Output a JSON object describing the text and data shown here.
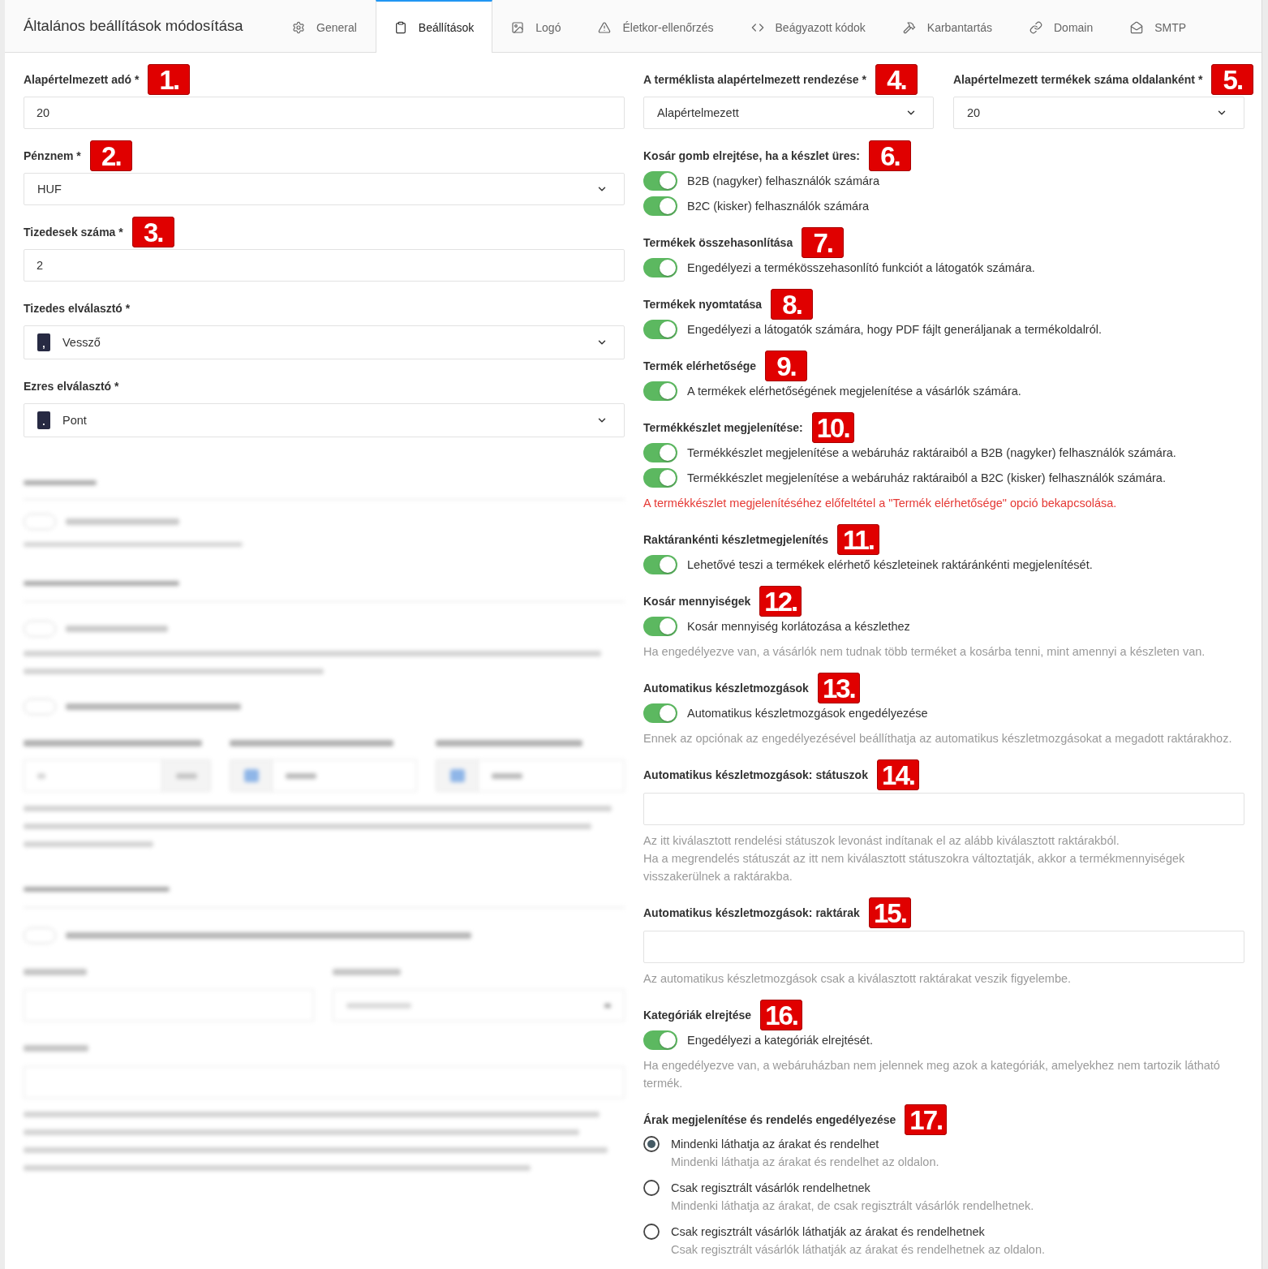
{
  "header": {
    "title": "Általános beállítások módosítása"
  },
  "tabs": [
    {
      "label": "General",
      "selected": false
    },
    {
      "label": "Beállítások",
      "selected": true
    },
    {
      "label": "Logó",
      "selected": false
    },
    {
      "label": "Életkor-ellenőrzés",
      "selected": false
    },
    {
      "label": "Beágyazott kódok",
      "selected": false
    },
    {
      "label": "Karbantartás",
      "selected": false
    },
    {
      "label": "Domain",
      "selected": false
    },
    {
      "label": "SMTP",
      "selected": false
    }
  ],
  "general_fields": [
    {
      "kind": "input",
      "label": "Alapértelmezett adó *",
      "marker": "1.",
      "value": "20"
    },
    {
      "kind": "select",
      "label": "Pénznem *",
      "marker": "2.",
      "value": "HUF"
    },
    {
      "kind": "input",
      "label": "Tizedesek száma *",
      "marker": "3.",
      "value": "2"
    },
    {
      "kind": "select",
      "label": "Tizedes elválasztó *",
      "symbol": ",",
      "value": "Vessző"
    },
    {
      "kind": "select",
      "label": "Ezres elválasztó *",
      "symbol": ".",
      "value": "Pont"
    }
  ],
  "list_fields": [
    {
      "label": "A terméklista alapértelmezett rendezése *",
      "marker": "4.",
      "value": "Alapértelmezett"
    },
    {
      "label": "Alapértelmezett termékek száma oldalanként *",
      "marker": "5.",
      "value": "20"
    }
  ],
  "sections": [
    {
      "title": "Kosár gomb elrejtése, ha a készlet üres:",
      "marker": "6.",
      "items": [
        {
          "kind": "toggle",
          "label": "B2B (nagyker) felhasználók számára",
          "on": true
        },
        {
          "kind": "toggle",
          "label": "B2C (kisker) felhasználók számára",
          "on": true
        }
      ]
    },
    {
      "title": "Termékek összehasonlítása",
      "marker": "7.",
      "items": [
        {
          "kind": "toggle",
          "label": "Engedélyezi a termékösszehasonlító funkciót a látogatók számára.",
          "on": true
        }
      ]
    },
    {
      "title": "Termékek nyomtatása",
      "marker": "8.",
      "items": [
        {
          "kind": "toggle",
          "label": "Engedélyezi a látogatók számára, hogy PDF fájlt generáljanak a termékoldalról.",
          "on": true
        }
      ]
    },
    {
      "title": "Termék elérhetősége",
      "marker": "9.",
      "items": [
        {
          "kind": "toggle",
          "label": "A termékek elérhetőségének megjelenítése a vásárlók számára.",
          "on": true
        }
      ]
    },
    {
      "title": "Termékkészlet megjelenítése:",
      "marker": "10.",
      "items": [
        {
          "kind": "toggle",
          "label": "Termékkészlet megjelenítése a webáruház raktáraiból a B2B (nagyker) felhasználók számára.",
          "on": true
        },
        {
          "kind": "toggle",
          "label": "Termékkészlet megjelenítése a webáruház raktáraiból a B2C (kisker) felhasználók számára.",
          "on": true
        },
        {
          "kind": "warning",
          "lines": [
            "A termékkészlet megjelenítéséhez előfeltétel a \"Termék elérhetősége\" opció bekapcsolása."
          ]
        }
      ]
    },
    {
      "title": "Raktárankénti készletmegjelenítés",
      "marker": "11.",
      "items": [
        {
          "kind": "toggle",
          "label": "Lehetővé teszi a termékek elérhető készleteinek raktáránkénti megjelenítését.",
          "on": true
        }
      ]
    },
    {
      "title": "Kosár mennyiségek",
      "marker": "12.",
      "items": [
        {
          "kind": "toggle",
          "label": "Kosár mennyiség korlátozása a készlethez",
          "on": true
        },
        {
          "kind": "hint",
          "lines": [
            "Ha engedélyezve van, a vásárlók nem tudnak több terméket a kosárba tenni, mint amennyi a készleten van."
          ]
        }
      ]
    },
    {
      "title": "Automatikus készletmozgások",
      "marker": "13.",
      "items": [
        {
          "kind": "toggle",
          "label": "Automatikus készletmozgások engedélyezése",
          "on": true
        },
        {
          "kind": "hint",
          "lines": [
            "Ennek az opciónak az engedélyezésével beállíthatja az automatikus készletmozgásokat a megadott raktárakhoz."
          ]
        }
      ]
    },
    {
      "title": "Automatikus készletmozgások: státuszok",
      "marker": "14.",
      "items": [
        {
          "kind": "input"
        },
        {
          "kind": "hint",
          "lines": [
            "Az itt kiválasztott rendelési státuszok levonást indítanak el az alább kiválasztott raktárakból.",
            "Ha a megrendelés státuszát az itt nem kiválasztott státuszokra változtatják, akkor a termékmennyiségek visszakerülnek a raktárakba."
          ]
        }
      ]
    },
    {
      "title": "Automatikus készletmozgások: raktárak",
      "marker": "15.",
      "items": [
        {
          "kind": "input"
        },
        {
          "kind": "hint",
          "lines": [
            "Az automatikus készletmozgások csak a kiválasztott raktárakat veszik figyelembe."
          ]
        }
      ]
    },
    {
      "title": "Kategóriák elrejtése",
      "marker": "16.",
      "items": [
        {
          "kind": "toggle",
          "label": "Engedélyezi a kategóriák elrejtését.",
          "on": true
        },
        {
          "kind": "hint",
          "lines": [
            "Ha engedélyezve van, a webáruházban nem jelennek meg azok a kategóriák, amelyekhez nem tartozik látható termék."
          ]
        }
      ]
    },
    {
      "title": "Árak megjelenítése és rendelés engedélyezése",
      "marker": "17.",
      "items": [
        {
          "kind": "radio",
          "label": "Mindenki láthatja az árakat és rendelhet",
          "description": "Mindenki láthatja az árakat és rendelhet az oldalon.",
          "selected": true
        },
        {
          "kind": "radio",
          "label": "Csak regisztrált vásárlók rendelhetnek",
          "description": "Mindenki láthatja az árakat, de csak regisztrált vásárlók rendelhetnek.",
          "selected": false
        },
        {
          "kind": "radio",
          "label": "Csak regisztrált vásárlók láthatják az árakat és rendelhetnek",
          "description": "Csak regisztrált vásárlók láthatják az árakat és rendelhetnek az oldalon.",
          "selected": false
        }
      ]
    }
  ]
}
